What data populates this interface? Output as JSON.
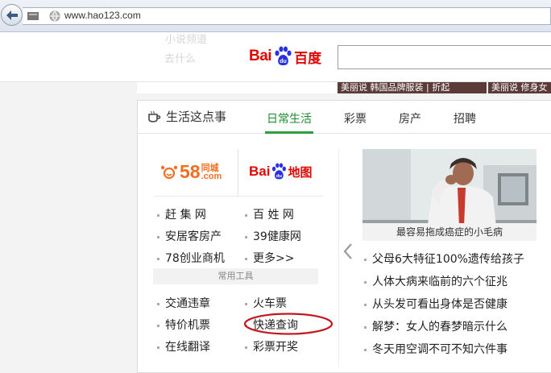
{
  "browser": {
    "url": "www.hao123.com"
  },
  "header": {
    "ghost_left": "小说频道",
    "ghost_under": "去什么",
    "baidu_logo_latin": "Bai",
    "baidu_logo_cn": "百度",
    "search_value": ""
  },
  "news_strip": [
    {
      "label": "美丽说   韩国品牌服装 | 折起"
    },
    {
      "label": "美丽说   修身女"
    }
  ],
  "panel": {
    "title": "生活这点事",
    "tabs": [
      {
        "label": "日常生活",
        "active": true
      },
      {
        "label": "彩票"
      },
      {
        "label": "房产"
      },
      {
        "label": "招聘"
      }
    ],
    "logos": {
      "tongcheng_num": "58",
      "tongcheng_cn": "同城",
      "tongcheng_com": ".com",
      "baidu_map_latin": "Bai",
      "baidu_map_cn": "地图"
    },
    "links": [
      {
        "label": "赶 集 网"
      },
      {
        "label": "百 姓 网"
      },
      {
        "label": "安居客房产"
      },
      {
        "label": "39健康网"
      },
      {
        "label": "78创业商机"
      },
      {
        "label": "更多>>"
      }
    ],
    "tools_header": "常用工具",
    "tools": [
      {
        "label": "交通违章"
      },
      {
        "label": "火车票"
      },
      {
        "label": "特价机票"
      },
      {
        "label": "快递查询"
      },
      {
        "label": "在线翻译"
      },
      {
        "label": "彩票开奖"
      }
    ],
    "featured_caption": "最容易拖成癌症的小毛病",
    "news": [
      {
        "label": "父母6大特征100%遗传给孩子"
      },
      {
        "label": "人体大病来临前的六个征兆"
      },
      {
        "label": "从头发可看出身体是否健康"
      },
      {
        "label": "解梦：女人的春梦暗示什么"
      },
      {
        "label": "冬天用空调不可不知六件事"
      }
    ]
  },
  "colors": {
    "baidu_red": "#e10602",
    "baidu_blue": "#2932e1",
    "active_tab": "#1b8a2f",
    "annotation_red": "#c4161c",
    "tongcheng_orange": "#f26f21"
  }
}
